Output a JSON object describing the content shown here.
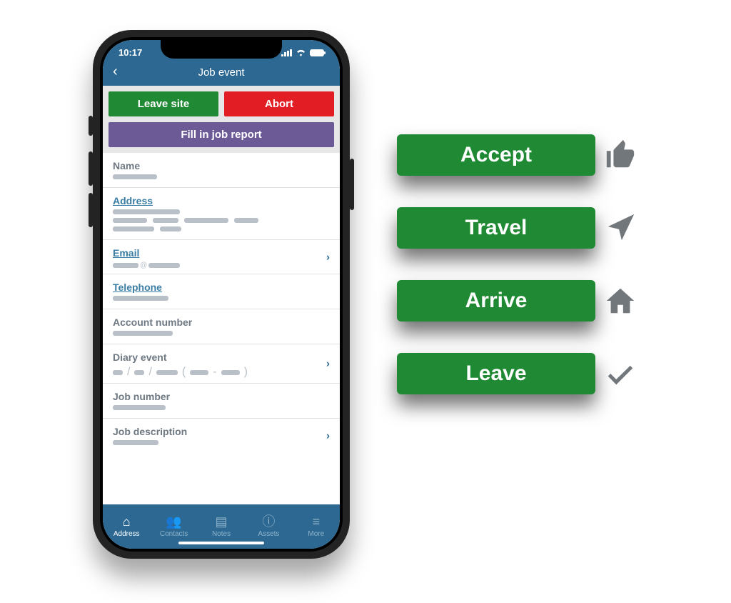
{
  "phone": {
    "status_time": "10:17",
    "nav_title": "Job event",
    "actions": {
      "leave_site": "Leave site",
      "abort": "Abort",
      "fill_report": "Fill in job report"
    },
    "fields": {
      "name": "Name",
      "address": "Address",
      "email": "Email",
      "telephone": "Telephone",
      "account_number": "Account number",
      "diary_event": "Diary event",
      "job_number": "Job number",
      "job_description": "Job description"
    },
    "tabs": {
      "address": "Address",
      "contacts": "Contacts",
      "notes": "Notes",
      "assets": "Assets",
      "more": "More"
    }
  },
  "stages": {
    "accept": "Accept",
    "travel": "Travel",
    "arrive": "Arrive",
    "leave": "Leave"
  }
}
